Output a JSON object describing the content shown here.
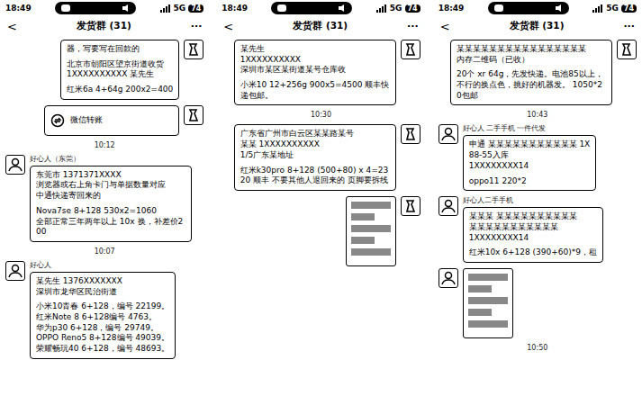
{
  "phones": [
    {
      "status": {
        "time": "18:49",
        "signal": "5G",
        "battery": "74"
      },
      "nav": {
        "back": "<",
        "title": "发货群 (31)",
        "more": "···"
      },
      "messages": [
        {
          "kind": "text",
          "side": "right",
          "sender": "",
          "paras": [
            [
              "器，写要写在回款的"
            ],
            [
              "北京市朝阳区望京街道收货",
              "1XXXXXXXXXX  某先生"
            ],
            [
              "红米6a 4+64g  200x2=400"
            ]
          ]
        },
        {
          "kind": "card",
          "side": "right",
          "sender": "",
          "paras": [
            [
              "微信转账"
            ]
          ]
        },
        {
          "kind": "time",
          "text": "10:12"
        },
        {
          "kind": "text",
          "side": "left",
          "sender": "好心人（东莞）",
          "paras": [
            [
              "东莞市 1371371XXXX",
              "浏览器或右上角卡门与单据数量对应",
              "中通快递寄回来的"
            ],
            [
              "Nova7se  8+128  530x2=1060",
              "全部正常三年两年以上 10x 换，补差价200"
            ]
          ]
        },
        {
          "kind": "time",
          "text": "10:07"
        },
        {
          "kind": "text",
          "side": "left",
          "sender": "好心人",
          "paras": [
            [
              "某先生  1376XXXXXXX",
              "深圳市龙华区民治街道"
            ],
            [
              "小米10青春 6+128，编号 22199。",
              "红米Note 8 6+128编号 4763。",
              "华为p30 6+128，编号 29749。",
              "OPPO Reno5 8+128编号 49039。",
              "荣耀畅玩40 6+128，编号 48693。"
            ]
          ]
        }
      ]
    },
    {
      "status": {
        "time": "18:49",
        "signal": "5G",
        "battery": "74"
      },
      "nav": {
        "back": "<",
        "title": "发货群 (31)",
        "more": "···"
      },
      "messages": [
        {
          "kind": "text",
          "side": "right",
          "sender": "",
          "paras": [
            [
              "某先生",
              "1XXXXXXXXXX",
              "深圳市某区某街道某号仓库收"
            ],
            [
              "小米10 12+256g  900x5=4500 顺丰快递包邮。"
            ]
          ]
        },
        {
          "kind": "time",
          "text": "10:30"
        },
        {
          "kind": "text",
          "side": "right",
          "sender": "",
          "paras": [
            [
              "广东省广州市白云区某某路某号",
              "某某 1XXXXXXXXXX",
              "1/5广东某地址"
            ],
            [
              "红米k30pro  8+128  (500+80) x 4=2320  顺丰  不要其他人退回来的 页脚要拆线"
            ]
          ]
        },
        {
          "kind": "image",
          "side": "right",
          "sender": "",
          "paras": []
        }
      ]
    },
    {
      "status": {
        "time": "18:49",
        "signal": "5G",
        "battery": "74"
      },
      "nav": {
        "back": "<",
        "title": "发货群 (31)",
        "more": "···"
      },
      "messages": [
        {
          "kind": "text",
          "side": "right",
          "sender": "",
          "paras": [
            [
              "某某某某某某某某某某某某某某某某",
              "内存二维码（已收）"
            ],
            [
              "20个 xr 64g，先发快递。电池85以上，不行的换点色，挑好的机器发。 1050*20包邮"
            ]
          ]
        },
        {
          "kind": "time",
          "text": "10:43"
        },
        {
          "kind": "text",
          "side": "left",
          "sender": "好心人 二手手机 一件代发",
          "paras": [
            [
              "申通 某某某某某某某某某某某 1X",
              "88-55入库",
              "1XXXXXXXX14"
            ],
            [
              "oppo11 220*2"
            ]
          ]
        },
        {
          "kind": "text",
          "side": "left",
          "sender": "好心人二手手机",
          "paras": [
            [
              "某某某 某某某某某某某某某某",
              "某某某某某某某某某某某",
              "1XXXXXXXX14"
            ],
            [
              "红米10x 6+128 (390+60)*9，租"
            ]
          ]
        },
        {
          "kind": "image",
          "side": "left",
          "sender": "",
          "paras": []
        },
        {
          "kind": "time",
          "text": "10:50"
        }
      ]
    }
  ]
}
